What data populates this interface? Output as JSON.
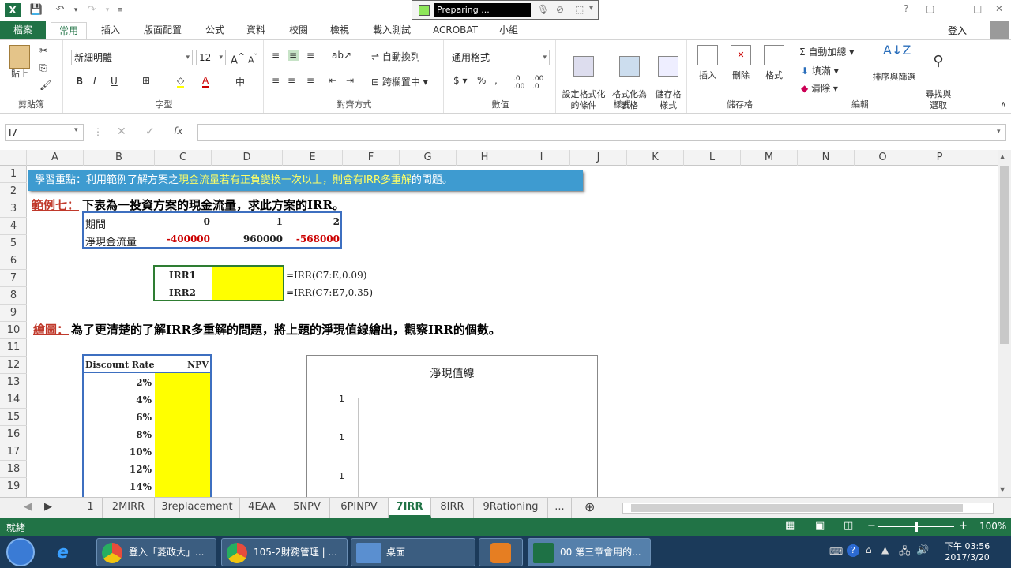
{
  "titlebar": {
    "logo": "X",
    "preparing_text": "Preparing ...",
    "help": "?",
    "controls": [
      "▢",
      "—",
      "□",
      "✕"
    ]
  },
  "tabs": {
    "file": "檔案",
    "items": [
      "常用",
      "插入",
      "版面配置",
      "公式",
      "資料",
      "校閱",
      "檢視",
      "載入測試",
      "ACROBAT",
      "小組"
    ],
    "login": "登入"
  },
  "ribbon": {
    "clipboard": {
      "paste": "貼上",
      "label": "剪貼簿"
    },
    "font": {
      "name": "新細明體",
      "size": "12",
      "label": "字型",
      "bold": "B",
      "italic": "I",
      "underline": "U"
    },
    "alignment": {
      "wrap": "自動換列",
      "merge": "跨欄置中",
      "label": "對齊方式"
    },
    "number": {
      "format": "通用格式",
      "label": "數值"
    },
    "styles": {
      "conditional": "設定格式化\n的條件",
      "table": "格式化為\n表格",
      "cell": "儲存格\n樣式",
      "label": "樣式"
    },
    "cells": {
      "insert": "插入",
      "delete": "刪除",
      "format": "格式",
      "label": "儲存格"
    },
    "editing": {
      "autosum": "自動加總",
      "fill": "填滿",
      "clear": "清除",
      "sort": "排序與篩選",
      "find": "尋找與\n選取",
      "label": "編輯"
    }
  },
  "formula_bar": {
    "name_box": "I7",
    "fx": "fx",
    "formula": ""
  },
  "columns": [
    "A",
    "B",
    "C",
    "D",
    "E",
    "F",
    "G",
    "H",
    "I",
    "J",
    "K",
    "L",
    "M",
    "N",
    "O",
    "P"
  ],
  "rows": [
    "1",
    "2",
    "3",
    "4",
    "5",
    "6",
    "7",
    "8",
    "9",
    "10",
    "11",
    "12",
    "13",
    "14",
    "15",
    "16",
    "17",
    "18",
    "19"
  ],
  "sheet": {
    "banner_pre": "學習重點：利用範例了解方案之",
    "banner_hl": "現金流量若有正負變換一次以上，則會有IRR多重解",
    "banner_post": "的問題。",
    "ex_label": "範例七：",
    "ex_text": "下表為一投資方案的現金流量，求此方案的IRR。",
    "period_label": "期間",
    "periods": [
      "0",
      "1",
      "2"
    ],
    "cf_label": "淨現金流量",
    "cashflows": [
      "-400000",
      "960000",
      "-568000"
    ],
    "irr1_label": "IRR1",
    "irr2_label": "IRR2",
    "irr1_formula": "=IRR(C7:E,0.09)",
    "irr2_formula": "=IRR(C7:E7,0.35)",
    "draw_label": "繪圖：",
    "draw_text": "為了更清楚的了解IRR多重解的問題，將上題的淨現值線繪出，觀察IRR的個數。",
    "dr_header": "Discount Rate",
    "npv_header": "NPV",
    "rates": [
      "2%",
      "4%",
      "6%",
      "8%",
      "10%",
      "12%",
      "14%"
    ]
  },
  "chart_data": {
    "type": "line",
    "title": "淨現值線",
    "yticks": [
      "1",
      "1",
      "1"
    ],
    "series": []
  },
  "sheet_tabs": [
    "1",
    "2MIRR",
    "3replacement",
    "4EAA",
    "5NPV",
    "6PINPV",
    "7IRR",
    "8IRR",
    "9Rationing",
    "..."
  ],
  "active_sheet": "7IRR",
  "status": {
    "ready": "就緒",
    "zoom": "100%"
  },
  "taskbar": {
    "items": [
      "登入「菱政大」...",
      "105-2財務管理 | ...",
      "桌面",
      "",
      "00 第三章會用的..."
    ],
    "time": "下午 03:56",
    "date": "2017/3/20"
  },
  "colors": {
    "excel_green": "#217346",
    "highlight_yellow": "#ffff00",
    "red_value": "#cc0000",
    "banner_blue": "#3e9bd0"
  }
}
